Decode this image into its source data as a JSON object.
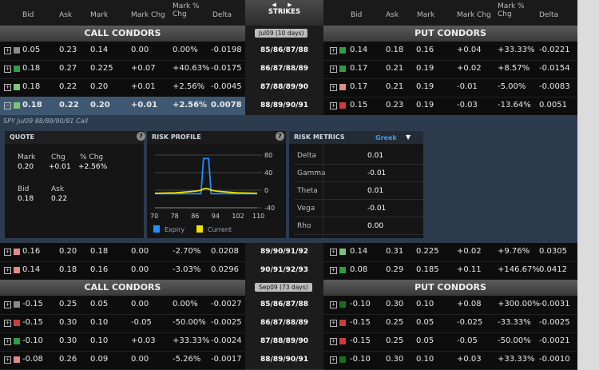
{
  "header": {
    "left": [
      "Bid",
      "Ask",
      "Mark",
      "Mark Chg",
      "Mark %\nChg",
      "Delta"
    ],
    "center": {
      "arrows": "◀ ▶",
      "label": "STRIKES"
    },
    "right": [
      "Bid",
      "Ask",
      "Mark",
      "Mark Chg",
      "Mark %\nChg",
      "Delta"
    ]
  },
  "sections": [
    {
      "call_title": "CALL CONDORS",
      "put_title": "PUT CONDORS",
      "expiry": "Jul09",
      "days": "(10 days)"
    },
    {
      "call_title": "CALL CONDORS",
      "put_title": "PUT CONDORS",
      "expiry": "Sep09",
      "days": "(73 days)"
    }
  ],
  "jul_rows": [
    {
      "strike": "85/86/87/88",
      "c": {
        "color": "#8a8a8a",
        "bid": "0.05",
        "ask": "0.23",
        "mark": "0.14",
        "chg": "0.00",
        "pct": "0.00%",
        "delta": "-0.0198"
      },
      "p": {
        "color": "#2e9e3e",
        "bid": "0.14",
        "ask": "0.18",
        "mark": "0.16",
        "chg": "+0.04",
        "pct": "+33.33%",
        "delta": "-0.0221"
      }
    },
    {
      "strike": "86/87/88/89",
      "c": {
        "color": "#2e9e3e",
        "bid": "0.18",
        "ask": "0.27",
        "mark": "0.225",
        "chg": "+0.07",
        "pct": "+40.63%",
        "delta": "-0.0175"
      },
      "p": {
        "color": "#2e9e3e",
        "bid": "0.17",
        "ask": "0.21",
        "mark": "0.19",
        "chg": "+0.02",
        "pct": "+8.57%",
        "delta": "-0.0154"
      }
    },
    {
      "strike": "87/88/89/90",
      "c": {
        "color": "#7cc27c",
        "bid": "0.18",
        "ask": "0.22",
        "mark": "0.20",
        "chg": "+0.01",
        "pct": "+2.56%",
        "delta": "-0.0045"
      },
      "p": {
        "color": "#e08a8a",
        "bid": "0.17",
        "ask": "0.21",
        "mark": "0.19",
        "chg": "-0.01",
        "pct": "-5.00%",
        "delta": "-0.0083"
      }
    },
    {
      "strike": "88/89/90/91",
      "c": {
        "color": "#7cc27c",
        "bid": "0.18",
        "ask": "0.22",
        "mark": "0.20",
        "chg": "+0.01",
        "pct": "+2.56%",
        "delta": "0.0078"
      },
      "p": {
        "color": "#d23a3a",
        "bid": "0.15",
        "ask": "0.23",
        "mark": "0.19",
        "chg": "-0.03",
        "pct": "-13.64%",
        "delta": "0.0051"
      }
    }
  ],
  "panel": {
    "title": "SPY Jul09 88/89/90/91 Call",
    "quote": {
      "head": "QUOTE",
      "mark_label": "Mark",
      "mark": "0.20",
      "chg_label": "Chg",
      "chg": "+0.01",
      "pct_label": "% Chg",
      "pct": "+2.56%",
      "bid_label": "Bid",
      "bid": "0.18",
      "ask_label": "Ask",
      "ask": "0.22"
    },
    "risk_profile": {
      "head": "RISK PROFILE",
      "legend_expiry": "Expiry",
      "legend_current": "Current",
      "expiry_color": "#1e90ff",
      "current_color": "#f0e000"
    },
    "risk_metrics": {
      "head": "RISK METRICS",
      "mode": "Greek",
      "rows": [
        {
          "label": "Delta",
          "value": "0.01"
        },
        {
          "label": "Gamma",
          "value": "-0.01"
        },
        {
          "label": "Theta",
          "value": "0.01"
        },
        {
          "label": "Vega",
          "value": "-0.01"
        },
        {
          "label": "Rho",
          "value": "0.00"
        }
      ]
    }
  },
  "chart_data": {
    "type": "line",
    "x": [
      70,
      78,
      86,
      88,
      89,
      90,
      91,
      92,
      94,
      102,
      110
    ],
    "xticks": [
      "70",
      "78",
      "86",
      "94",
      "102",
      "110"
    ],
    "yticks": [
      "80",
      "40",
      "0",
      "-40"
    ],
    "ylim": [
      -40,
      80
    ],
    "series": [
      {
        "name": "Expiry",
        "y": [
          -8,
          -8,
          -8,
          -8,
          72,
          72,
          72,
          -8,
          -8,
          -8,
          -8
        ]
      },
      {
        "name": "Current",
        "y": [
          -7,
          -6,
          -2,
          0,
          3,
          4,
          3,
          0,
          -2,
          -6,
          -7
        ]
      }
    ]
  },
  "after_rows": [
    {
      "strike": "89/90/91/92",
      "c": {
        "color": "#e08a8a",
        "bid": "0.16",
        "ask": "0.20",
        "mark": "0.18",
        "chg": "0.00",
        "pct": "-2.70%",
        "delta": "0.0208"
      },
      "p": {
        "color": "#7cc27c",
        "bid": "0.14",
        "ask": "0.31",
        "mark": "0.225",
        "chg": "+0.02",
        "pct": "+9.76%",
        "delta": "0.0305"
      }
    },
    {
      "strike": "90/91/92/93",
      "c": {
        "color": "#e08a8a",
        "bid": "0.14",
        "ask": "0.18",
        "mark": "0.16",
        "chg": "0.00",
        "pct": "-3.03%",
        "delta": "0.0296"
      },
      "p": {
        "color": "#2e9e3e",
        "bid": "0.08",
        "ask": "0.29",
        "mark": "0.185",
        "chg": "+0.11",
        "pct": "+146.67%",
        "delta": "0.0412"
      }
    }
  ],
  "sep_rows": [
    {
      "strike": "85/86/87/88",
      "c": {
        "color": "#8a8a8a",
        "bid": "-0.15",
        "ask": "0.25",
        "mark": "0.05",
        "chg": "0.00",
        "pct": "0.00%",
        "delta": "-0.0027"
      },
      "p": {
        "color": "#1a6e1a",
        "bid": "-0.10",
        "ask": "0.30",
        "mark": "0.10",
        "chg": "+0.08",
        "pct": "+300.00%",
        "delta": "-0.0031"
      }
    },
    {
      "strike": "86/87/88/89",
      "c": {
        "color": "#d23a3a",
        "bid": "-0.15",
        "ask": "0.30",
        "mark": "0.10",
        "chg": "-0.05",
        "pct": "-50.00%",
        "delta": "-0.0025"
      },
      "p": {
        "color": "#d23a3a",
        "bid": "-0.15",
        "ask": "0.25",
        "mark": "0.05",
        "chg": "-0.025",
        "pct": "-33.33%",
        "delta": "-0.0025"
      }
    },
    {
      "strike": "87/88/89/90",
      "c": {
        "color": "#2e9e3e",
        "bid": "-0.10",
        "ask": "0.30",
        "mark": "0.10",
        "chg": "+0.03",
        "pct": "+33.33%",
        "delta": "-0.0024"
      },
      "p": {
        "color": "#d23a3a",
        "bid": "-0.15",
        "ask": "0.25",
        "mark": "0.05",
        "chg": "-0.05",
        "pct": "-50.00%",
        "delta": "-0.0021"
      }
    },
    {
      "strike": "88/89/90/91",
      "c": {
        "color": "#e08a8a",
        "bid": "-0.08",
        "ask": "0.26",
        "mark": "0.09",
        "chg": "0.00",
        "pct": "-5.26%",
        "delta": "-0.0017"
      },
      "p": {
        "color": "#1a6e1a",
        "bid": "-0.10",
        "ask": "0.30",
        "mark": "0.10",
        "chg": "+0.03",
        "pct": "+33.33%",
        "delta": "-0.0010"
      }
    }
  ]
}
